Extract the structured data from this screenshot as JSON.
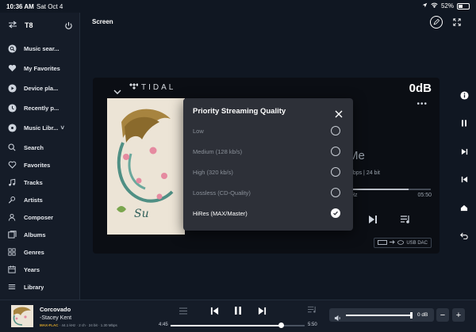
{
  "status_bar": {
    "time": "10:36 AM",
    "date": "Sat Oct 4",
    "battery_text": "52%",
    "battery_level": 0.52
  },
  "sidebar": {
    "device_name": "T8",
    "items": [
      {
        "label": "Music sear...",
        "icon": "search-circle-icon"
      },
      {
        "label": "My Favorites",
        "icon": "heart-icon"
      },
      {
        "label": "Device pla...",
        "icon": "play-circle-icon"
      },
      {
        "label": "Recently p...",
        "icon": "clock-icon"
      },
      {
        "label": "Music Libr...",
        "icon": "disc-icon",
        "has_dropdown": true,
        "dropdown_glyph": "˅"
      },
      {
        "label": "Search",
        "icon": "search-icon"
      },
      {
        "label": "Favorites",
        "icon": "heart-outline-icon"
      },
      {
        "label": "Tracks",
        "icon": "music-note-icon"
      },
      {
        "label": "Artists",
        "icon": "mic-icon"
      },
      {
        "label": "Composer",
        "icon": "person-icon"
      },
      {
        "label": "Albums",
        "icon": "albums-icon"
      },
      {
        "label": "Genres",
        "icon": "grid-icon"
      },
      {
        "label": "Years",
        "icon": "calendar-icon"
      },
      {
        "label": "Library",
        "icon": "library-icon"
      }
    ]
  },
  "topbar": {
    "title": "Screen"
  },
  "panel": {
    "service": "TIDAL",
    "volume_db": "0dB",
    "more_glyph": "•••",
    "bg_title_fragment": "Me",
    "bg_info_fragment": "Mbps | 24 bit",
    "bg_rate_fragment": "Hz",
    "bg_duration": "05:50",
    "bg_progress": 0.73,
    "output_label": "USB DAC"
  },
  "modal": {
    "title": "Priority Streaming Quality",
    "options": [
      {
        "label": "Low",
        "selected": false
      },
      {
        "label": "Medium (128 kb/s)",
        "selected": false
      },
      {
        "label": "High (320 kb/s)",
        "selected": false
      },
      {
        "label": "Lossless (CD-Quality)",
        "selected": false
      },
      {
        "label": "HiRes (MAX/Master)",
        "selected": true
      }
    ]
  },
  "now_playing": {
    "title": "Corcovado",
    "artist": "-Stacey Kent",
    "format_badge": "MAX-FLAC",
    "format_details": " · 44.1 kHz · 2 ch · 24 bit · 1.30 Mbps",
    "elapsed": "4:45",
    "duration": "5:50",
    "progress": 0.82,
    "volume_label": "0 dB",
    "volume_level": 1.0,
    "minus_label": "−",
    "plus_label": "+"
  },
  "colors": {
    "background": "#101722",
    "sidebar": "#151c28",
    "modal": "#2d3038",
    "accent_gold": "#d6a32a"
  }
}
